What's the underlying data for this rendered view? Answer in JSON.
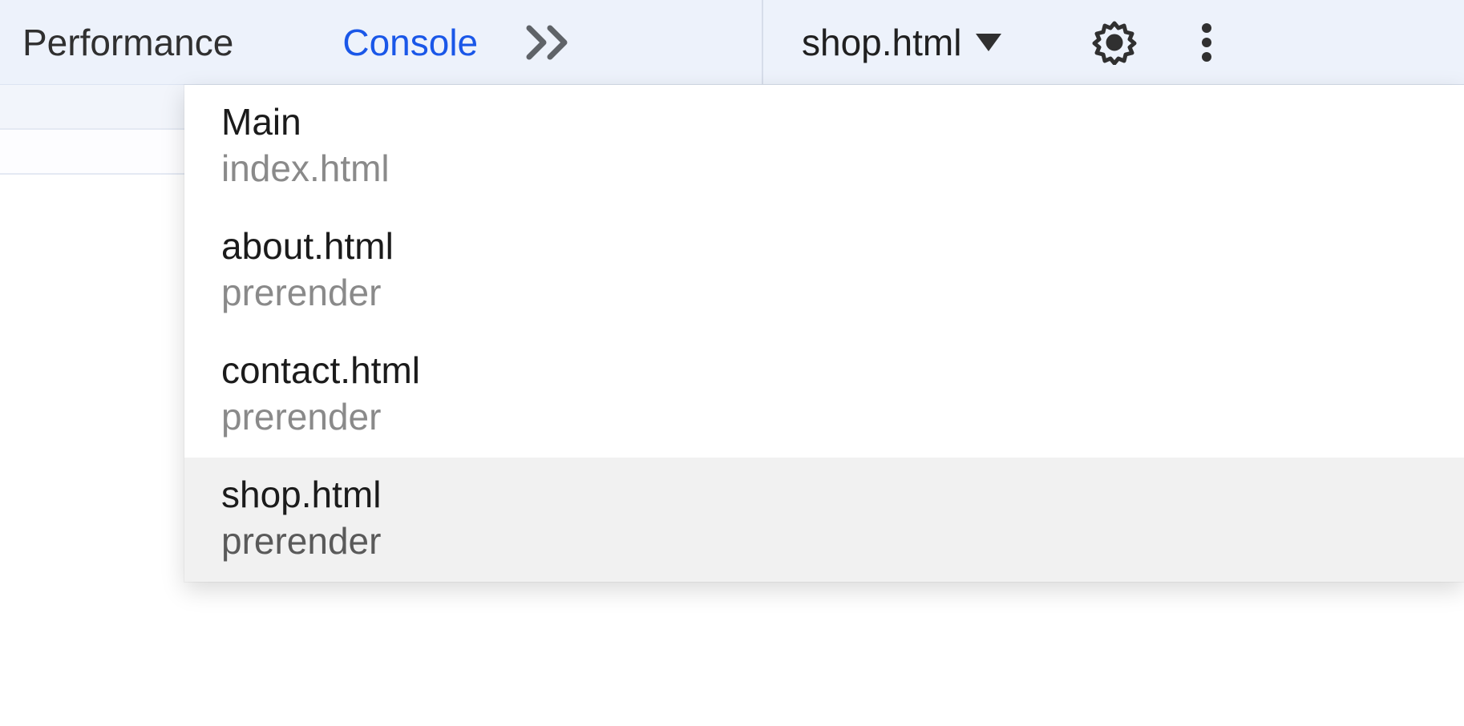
{
  "toolbar": {
    "tabs": {
      "performance": "Performance",
      "console": "Console"
    },
    "target_selected": "shop.html"
  },
  "dropdown": {
    "items": [
      {
        "primary": "Main",
        "secondary": "index.html",
        "highlight": false
      },
      {
        "primary": "about.html",
        "secondary": "prerender",
        "highlight": false
      },
      {
        "primary": "contact.html",
        "secondary": "prerender",
        "highlight": false
      },
      {
        "primary": "shop.html",
        "secondary": "prerender",
        "highlight": true
      }
    ]
  }
}
